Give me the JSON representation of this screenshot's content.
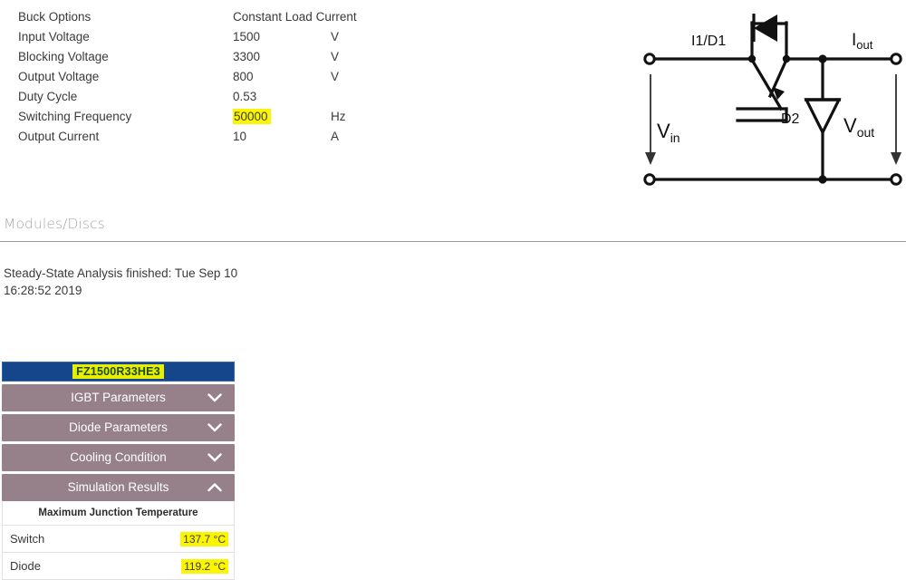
{
  "parameters": {
    "rows": [
      {
        "name": "Buck Options",
        "value": "Constant Load Current",
        "unit": "",
        "highlight": false
      },
      {
        "name": "Input Voltage",
        "value": "1500",
        "unit": "V",
        "highlight": false
      },
      {
        "name": "Blocking Voltage",
        "value": "3300",
        "unit": "V",
        "highlight": false
      },
      {
        "name": "Output Voltage",
        "value": "800",
        "unit": "V",
        "highlight": false
      },
      {
        "name": "Duty Cycle",
        "value": "0.53",
        "unit": "",
        "highlight": false
      },
      {
        "name": "Switching Frequency",
        "value": "50000",
        "unit": "Hz",
        "highlight": true
      },
      {
        "name": "Output Current",
        "value": "10",
        "unit": "A",
        "highlight": false
      }
    ]
  },
  "modules_section": {
    "title": "Modules/Discs"
  },
  "status": {
    "message": "Steady-State Analysis finished: Tue Sep 10 16:28:52 2019"
  },
  "module_panel": {
    "device_name": "FZ1500R33HE3",
    "accordion": [
      {
        "label": "IGBT Parameters",
        "expanded": false,
        "icon": "chevron-down-icon"
      },
      {
        "label": "Diode Parameters",
        "expanded": false,
        "icon": "chevron-down-icon"
      },
      {
        "label": "Cooling Condition",
        "expanded": false,
        "icon": "chevron-down-icon"
      },
      {
        "label": "Simulation Results",
        "expanded": true,
        "icon": "chevron-up-icon"
      }
    ],
    "results": {
      "subheading": "Maximum Junction Temperature",
      "rows": [
        {
          "label": "Switch",
          "value": "137.7 °C"
        },
        {
          "label": "Diode",
          "value": "119.2 °C"
        }
      ]
    }
  },
  "circuit": {
    "labels": {
      "switch": "I1/D1",
      "diode": "D2",
      "input_voltage": "V",
      "input_voltage_sub": "in",
      "output_voltage": "V",
      "output_voltage_sub": "out",
      "output_current": "I",
      "output_current_sub": "out"
    }
  },
  "colors": {
    "titlebar": "#15468c",
    "accordion_header": "#96818a",
    "highlight_yellow": "#fbf500",
    "device_highlight": "#e8ee00",
    "section_heading": "#a8a8a8",
    "body_text": "#3a3a3a"
  }
}
